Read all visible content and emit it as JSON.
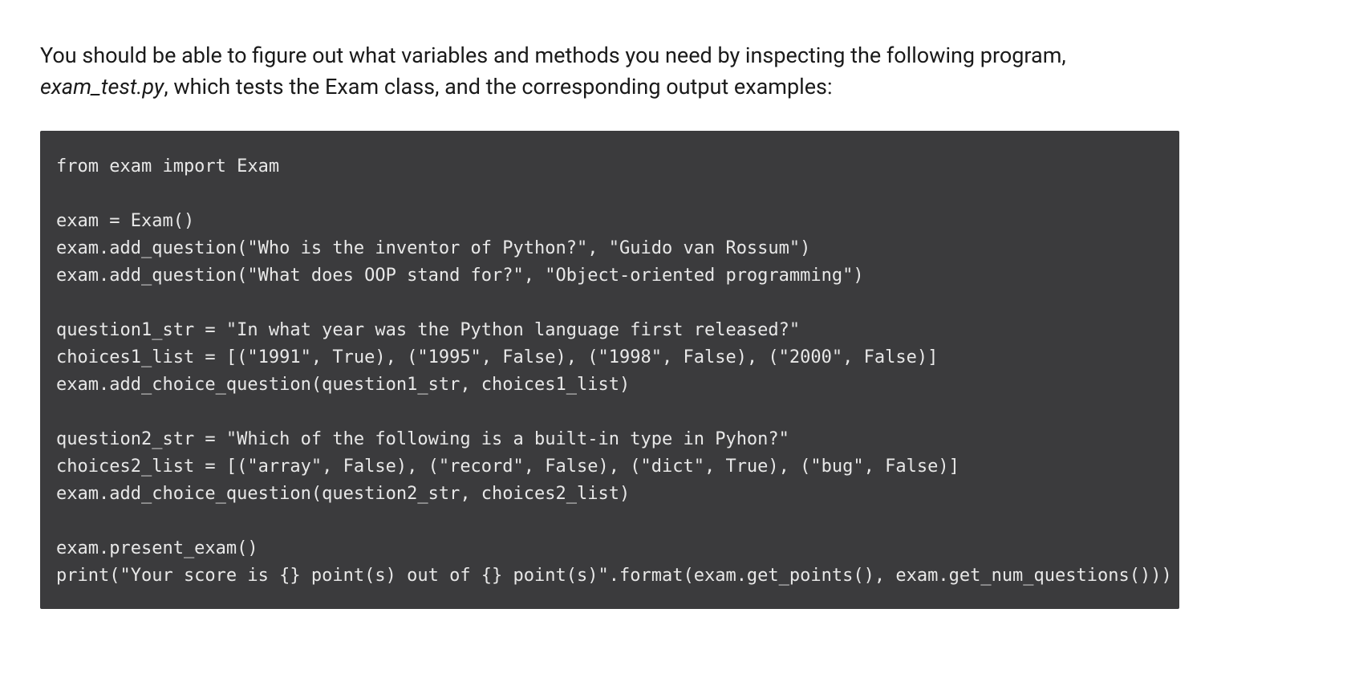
{
  "intro": {
    "text_before_em": "You should be able to figure out what variables and methods you need by inspecting the following program, ",
    "em_text": "exam_test.py",
    "text_after_em": ", which tests the Exam class, and the corresponding output examples:"
  },
  "code": {
    "content": "from exam import Exam\n\nexam = Exam()\nexam.add_question(\"Who is the inventor of Python?\", \"Guido van Rossum\")\nexam.add_question(\"What does OOP stand for?\", \"Object-oriented programming\")\n\nquestion1_str = \"In what year was the Python language first released?\"\nchoices1_list = [(\"1991\", True), (\"1995\", False), (\"1998\", False), (\"2000\", False)]\nexam.add_choice_question(question1_str, choices1_list)\n\nquestion2_str = \"Which of the following is a built-in type in Pyhon?\"\nchoices2_list = [(\"array\", False), (\"record\", False), (\"dict\", True), (\"bug\", False)]\nexam.add_choice_question(question2_str, choices2_list)\n\nexam.present_exam()\nprint(\"Your score is {} point(s) out of {} point(s)\".format(exam.get_points(), exam.get_num_questions()))"
  }
}
